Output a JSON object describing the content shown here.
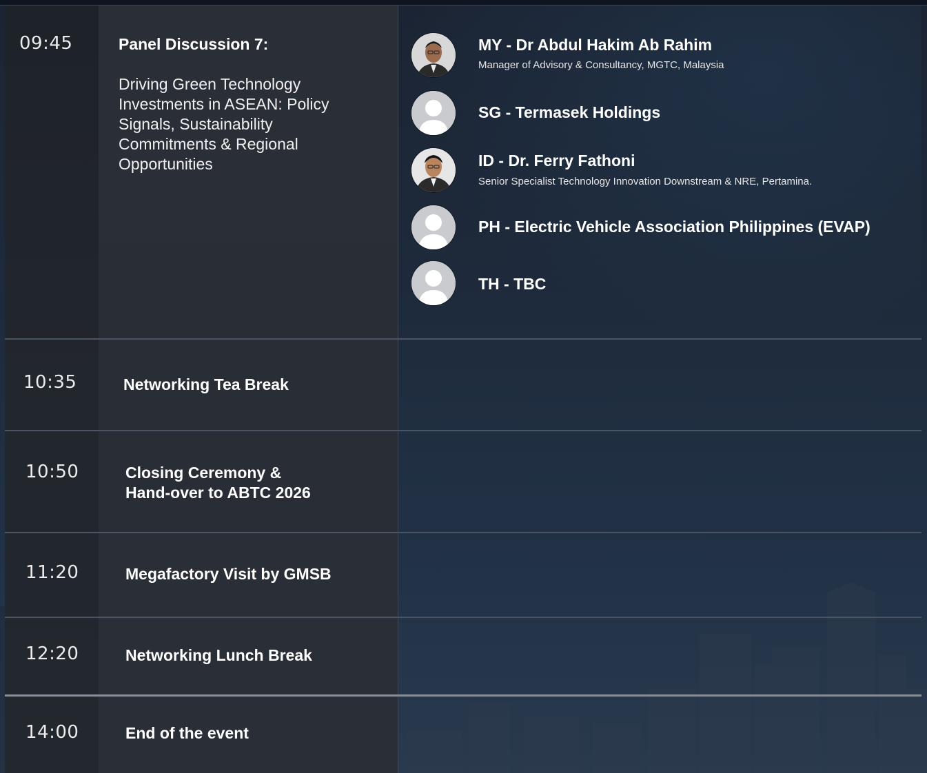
{
  "agenda": [
    {
      "time": "09:45",
      "title": "Panel Discussion 7:",
      "description": "Driving Green Technology Investments in ASEAN: Policy Signals, Sustainability Commitments & Regional Opportunities",
      "speakers": [
        {
          "name": "MY - Dr Abdul Hakim Ab Rahim",
          "role": "Manager of Advisory & Consultancy, MGTC, Malaysia",
          "avatar": "person-photo-icon"
        },
        {
          "name": "SG - Termasek Holdings",
          "role": "",
          "avatar": "user-placeholder-icon"
        },
        {
          "name": "ID - Dr. Ferry Fathoni",
          "role": "Senior Specialist Technology Innovation Downstream & NRE, Pertamina.",
          "avatar": "person-photo-icon"
        },
        {
          "name": "PH - Electric Vehicle Association Philippines (EVAP)",
          "role": "",
          "avatar": "user-placeholder-icon"
        },
        {
          "name": "TH - TBC",
          "role": "",
          "avatar": "user-placeholder-icon"
        }
      ]
    },
    {
      "time": "10:35",
      "title": "Networking Tea Break"
    },
    {
      "time": "10:50",
      "title_line1": "Closing Ceremony &",
      "title_line2": "Hand-over to ABTC 2026"
    },
    {
      "time": "11:20",
      "title": "Megafactory Visit by GMSB"
    },
    {
      "time": "12:20",
      "title": "Networking Lunch Break"
    },
    {
      "time": "14:00",
      "title": "End of the event"
    }
  ],
  "colors": {
    "background": "#1e2b3c",
    "time_column": "#22262d",
    "title_column": "#2a2e37",
    "divider": "#4a5462",
    "text": "#ffffff"
  }
}
